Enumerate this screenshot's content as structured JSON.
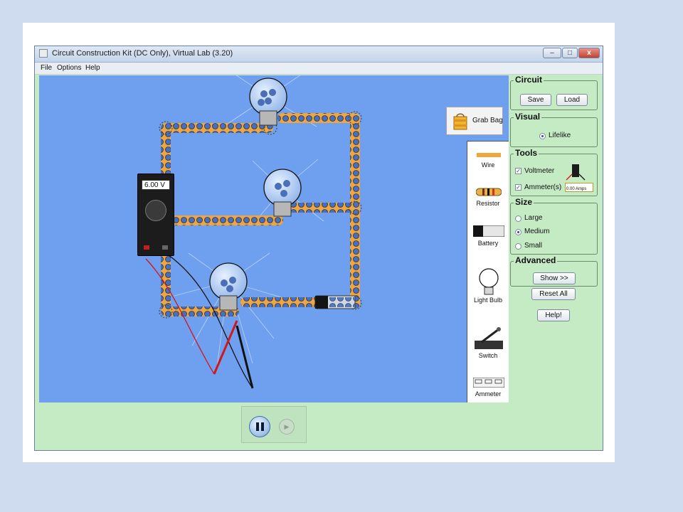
{
  "window": {
    "title": "Circuit Construction Kit (DC Only), Virtual Lab (3.20)",
    "controls": {
      "minimize": "–",
      "maximize": "□",
      "close": "x"
    }
  },
  "menu": {
    "file": "File",
    "options": "Options",
    "help": "Help"
  },
  "grab_bag": {
    "label": "Grab Bag"
  },
  "toolbox": {
    "wire": "Wire",
    "resistor": "Resistor",
    "battery": "Battery",
    "light_bulb": "Light Bulb",
    "switch": "Switch",
    "ammeter": "Ammeter"
  },
  "voltmeter": {
    "reading": "6.00 V"
  },
  "panels": {
    "circuit": {
      "title": "Circuit",
      "save": "Save",
      "load": "Load"
    },
    "visual": {
      "title": "Visual",
      "lifelike": "Lifelike",
      "lifelike_selected": true
    },
    "tools": {
      "title": "Tools",
      "voltmeter": "Voltmeter",
      "voltmeter_checked": true,
      "ammeter": "Ammeter(s)",
      "ammeter_checked": true,
      "ammeter_reading": "0.00 Amps"
    },
    "size": {
      "title": "Size",
      "large": "Large",
      "medium": "Medium",
      "small": "Small",
      "selected": "Medium"
    },
    "advanced": {
      "title": "Advanced",
      "show": "Show >>"
    }
  },
  "buttons": {
    "reset_all": "Reset All",
    "help": "Help!"
  },
  "playback": {
    "state": "playing"
  },
  "colors": {
    "canvas": "#6fa0ef",
    "panel_bg": "#c4ebc4",
    "wire": "#f0a63c",
    "electron": "#4a6fb8"
  }
}
